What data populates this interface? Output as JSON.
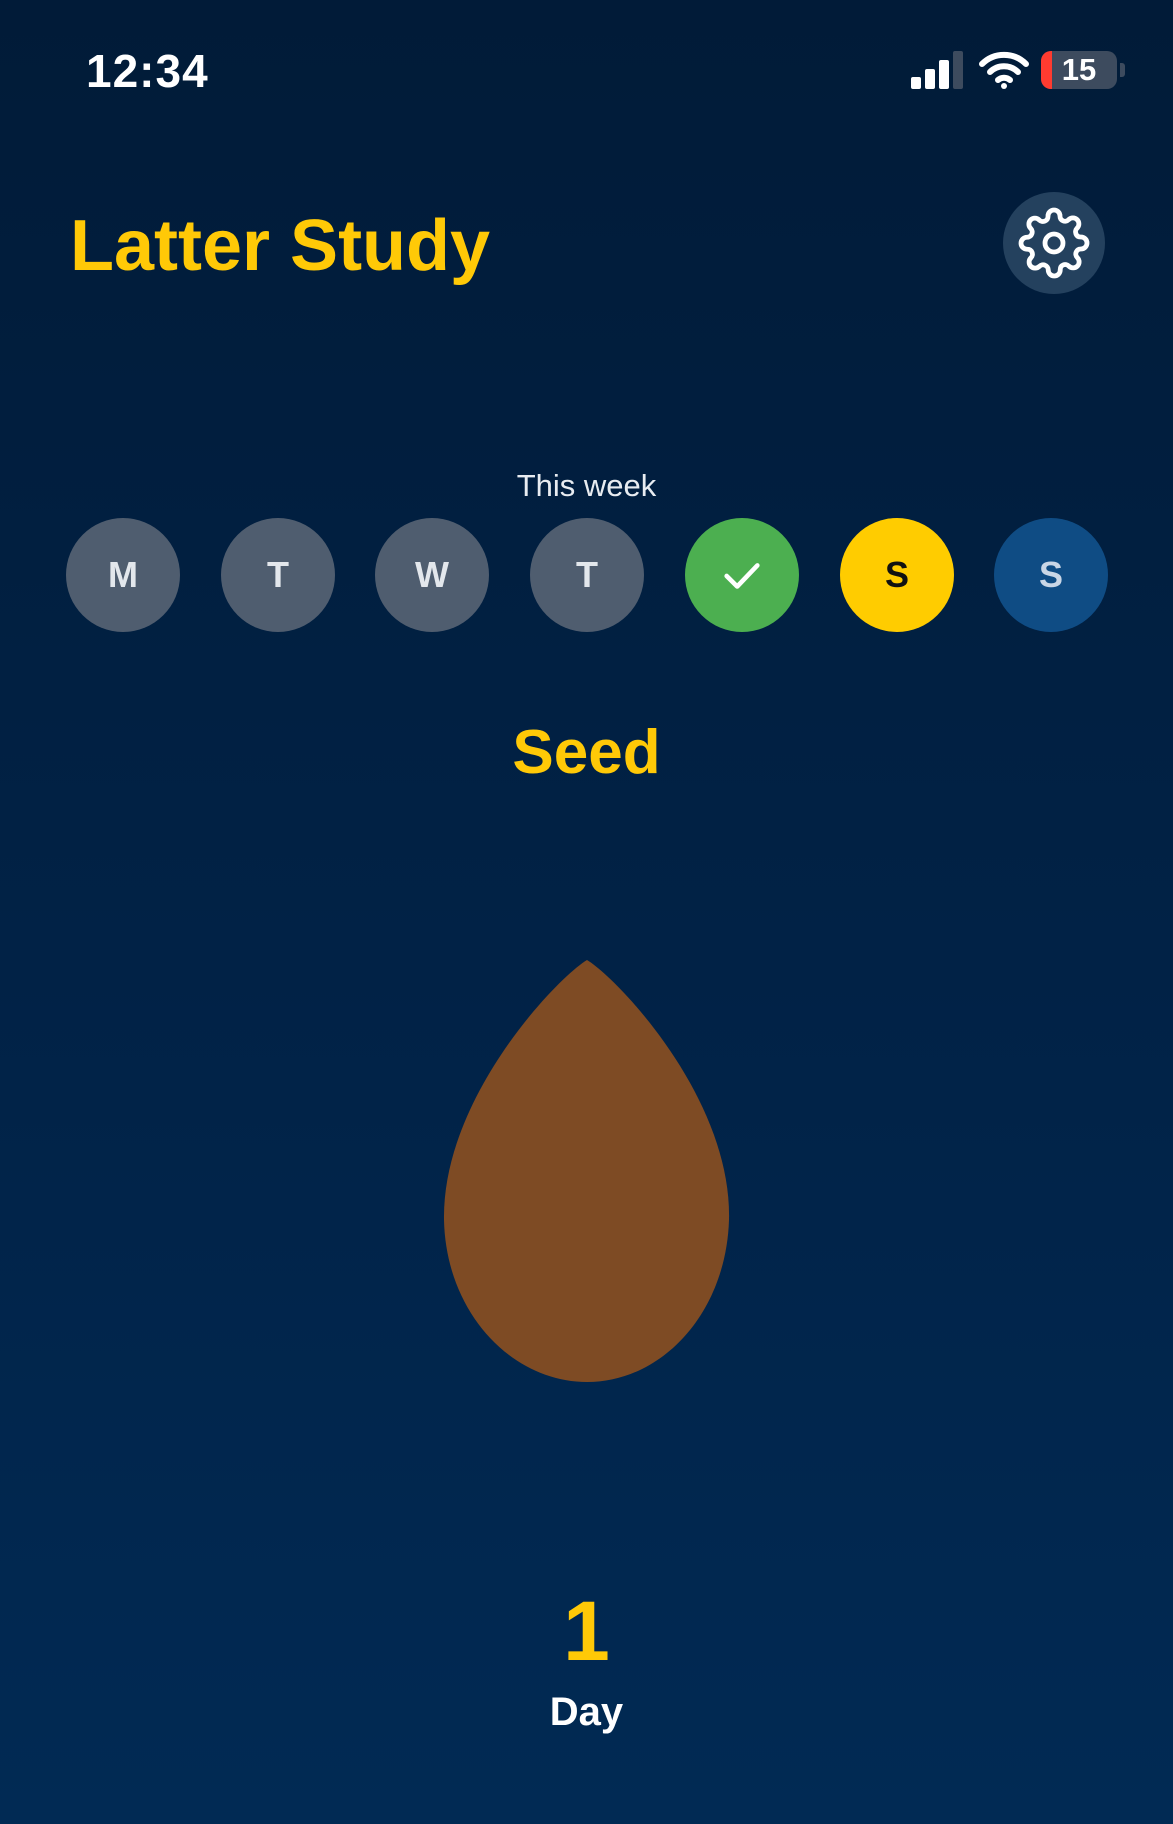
{
  "status_bar": {
    "time": "12:34",
    "battery_percent": "15",
    "battery_level": 0.15,
    "icons": [
      "signal-icon",
      "wifi-icon",
      "battery-icon"
    ]
  },
  "header": {
    "title": "Latter Study",
    "settings_icon": "gear-icon"
  },
  "week": {
    "label": "This week",
    "days": [
      {
        "label": "M",
        "state": "past"
      },
      {
        "label": "T",
        "state": "past"
      },
      {
        "label": "W",
        "state": "past"
      },
      {
        "label": "T",
        "state": "past"
      },
      {
        "label": "",
        "state": "completed",
        "icon": "checkmark-icon"
      },
      {
        "label": "S",
        "state": "today"
      },
      {
        "label": "S",
        "state": "future"
      }
    ]
  },
  "stage": {
    "name": "Seed",
    "illustration": "seed-icon"
  },
  "streak": {
    "count": "1",
    "unit": "Day"
  },
  "colors": {
    "accent": "#ffc907",
    "background_top": "#011b38",
    "background_bottom": "#012a54",
    "day_past": "#4f5d6f",
    "day_completed": "#4caf50",
    "day_today": "#ffcc00",
    "day_future": "#0f4c84",
    "seed": "#7e4b24",
    "settings_button": "#24415e"
  }
}
